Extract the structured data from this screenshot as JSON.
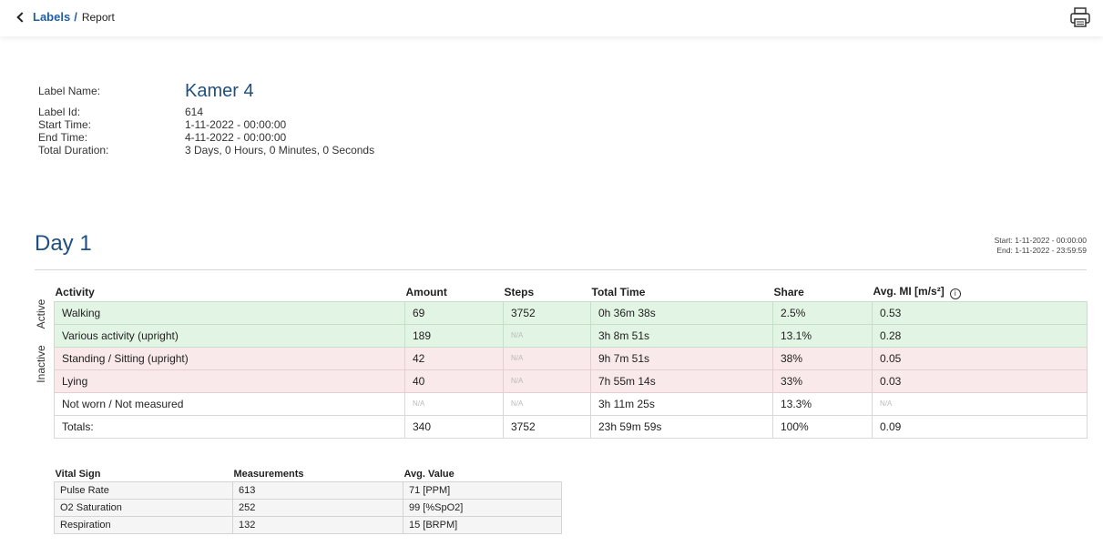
{
  "breadcrumb": {
    "parent": "Labels",
    "separator": "/",
    "current": "Report"
  },
  "label_info": {
    "name_key": "Label Name:",
    "name_value": "Kamer 4",
    "rows": [
      {
        "key": "Label Id:",
        "value": "614"
      },
      {
        "key": "Start Time:",
        "value": "1-11-2022 - 00:00:00"
      },
      {
        "key": "End Time:",
        "value": "4-11-2022 - 00:00:00"
      },
      {
        "key": "Total Duration:",
        "value": "3 Days, 0 Hours, 0 Minutes, 0 Seconds"
      }
    ]
  },
  "day": {
    "title": "Day 1",
    "start": "Start: 1-11-2022 - 00:00:00",
    "end": "End: 1-11-2022 - 23:59:59"
  },
  "activity_table": {
    "group_labels": {
      "active": "Active",
      "inactive": "Inactive"
    },
    "headers": [
      "Activity",
      "Amount",
      "Steps",
      "Total Time",
      "Share",
      "Avg. MI [m/s²]"
    ],
    "info_icon": "info-icon",
    "rows": [
      [
        "Walking",
        "69",
        "3752",
        "0h 36m 38s",
        "2.5%",
        "0.53"
      ],
      [
        "Various activity (upright)",
        "189",
        "N/A",
        "3h 8m 51s",
        "13.1%",
        "0.28"
      ],
      [
        "Standing / Sitting (upright)",
        "42",
        "N/A",
        "9h 7m 51s",
        "38%",
        "0.05"
      ],
      [
        "Lying",
        "40",
        "N/A",
        "7h 55m 14s",
        "33%",
        "0.03"
      ],
      [
        "Not worn / Not measured",
        "N/A",
        "N/A",
        "3h 11m 25s",
        "13.3%",
        "N/A"
      ],
      [
        "Totals:",
        "340",
        "3752",
        "23h 59m 59s",
        "100%",
        "0.09"
      ]
    ],
    "colors": {
      "active_bg": "#e2f4e3",
      "inactive_bg": "#f9e9ea"
    }
  },
  "vitals_table": {
    "headers": [
      "Vital Sign",
      "Measurements",
      "Avg. Value"
    ],
    "rows": [
      [
        "Pulse Rate",
        "613",
        "71 [PPM]"
      ],
      [
        "O2 Saturation",
        "252",
        "99 [%SpO2]"
      ],
      [
        "Respiration",
        "132",
        "15 [BRPM]"
      ]
    ]
  },
  "colors": {
    "accent": "#1f4f80",
    "link": "#1f5fa6"
  }
}
